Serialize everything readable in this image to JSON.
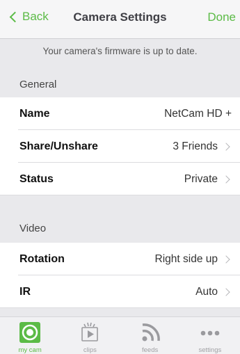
{
  "nav": {
    "back_label": "Back",
    "title": "Camera Settings",
    "done_label": "Done"
  },
  "banner": {
    "text": "Your camera's firmware is up to date."
  },
  "sections": {
    "general": {
      "header": "General",
      "rows": [
        {
          "label": "Name",
          "value": "NetCam HD +"
        },
        {
          "label": "Share/Unshare",
          "value": "3 Friends"
        },
        {
          "label": "Status",
          "value": "Private"
        }
      ]
    },
    "video": {
      "header": "Video",
      "rows": [
        {
          "label": "Rotation",
          "value": "Right side up"
        },
        {
          "label": "IR",
          "value": "Auto"
        }
      ]
    }
  },
  "tabbar": {
    "tabs": [
      {
        "label": "my cam",
        "icon": "camera-icon",
        "active": true
      },
      {
        "label": "clips",
        "icon": "clips-icon",
        "active": false
      },
      {
        "label": "feeds",
        "icon": "feeds-icon",
        "active": false
      },
      {
        "label": "settings",
        "icon": "more-icon",
        "active": false
      }
    ]
  },
  "colors": {
    "accent": "#5bbb46",
    "background": "#e9e9ec",
    "row_background": "#ffffff"
  }
}
